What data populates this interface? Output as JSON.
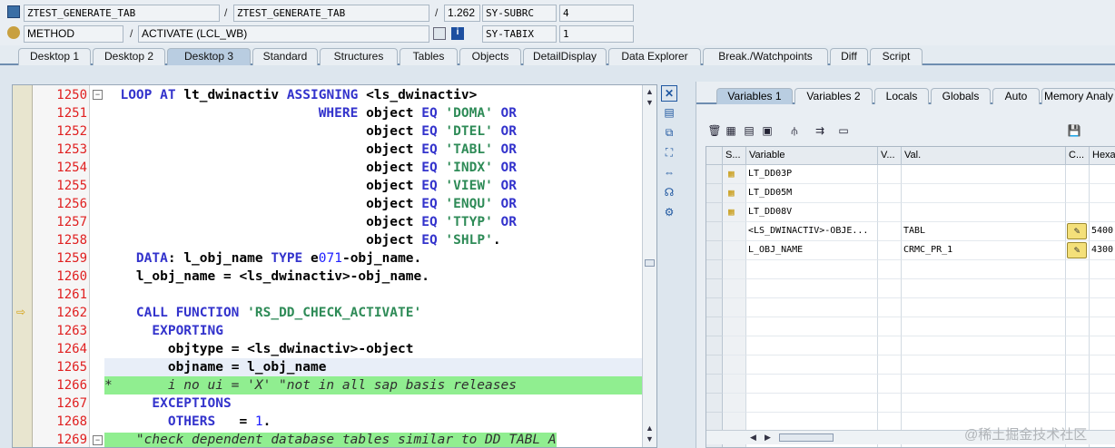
{
  "header": {
    "row1": {
      "program": "ZTEST_GENERATE_TAB",
      "include": "ZTEST_GENERATE_TAB",
      "line": "1.262",
      "sysfield": "SY-SUBRC",
      "sysvalue": "4"
    },
    "row2": {
      "eventtype": "METHOD",
      "event": "ACTIVATE (LCL_WB)",
      "sysfield": "SY-TABIX",
      "sysvalue": "1"
    },
    "sep": "/"
  },
  "tabs": [
    "Desktop 1",
    "Desktop 2",
    "Desktop 3",
    "Standard",
    "Structures",
    "Tables",
    "Objects",
    "DetailDisplay",
    "Data Explorer",
    "Break./Watchpoints",
    "Diff",
    "Script"
  ],
  "active_tab": "Desktop 3",
  "editor": {
    "lines": [
      {
        "n": "1250",
        "text": "  LOOP AT lt_dwinactiv ASSIGNING <ls_dwinactiv>"
      },
      {
        "n": "1251",
        "text": "                           WHERE object EQ 'DOMA' OR"
      },
      {
        "n": "1252",
        "text": "                                 object EQ 'DTEL' OR"
      },
      {
        "n": "1253",
        "text": "                                 object EQ 'TABL' OR"
      },
      {
        "n": "1254",
        "text": "                                 object EQ 'INDX' OR"
      },
      {
        "n": "1255",
        "text": "                                 object EQ 'VIEW' OR"
      },
      {
        "n": "1256",
        "text": "                                 object EQ 'ENQU' OR"
      },
      {
        "n": "1257",
        "text": "                                 object EQ 'TTYP' OR"
      },
      {
        "n": "1258",
        "text": "                                 object EQ 'SHLP'."
      },
      {
        "n": "1259",
        "text": "    DATA: l_obj_name TYPE e071-obj_name."
      },
      {
        "n": "1260",
        "text": "    l_obj_name = <ls_dwinactiv>-obj_name."
      },
      {
        "n": "1261",
        "text": ""
      },
      {
        "n": "1262",
        "text": "    CALL FUNCTION 'RS_DD_CHECK_ACTIVATE'"
      },
      {
        "n": "1263",
        "text": "      EXPORTING"
      },
      {
        "n": "1264",
        "text": "        objtype = <ls_dwinactiv>-object"
      },
      {
        "n": "1265",
        "text": "        objname = l_obj_name"
      },
      {
        "n": "1266",
        "text": "*       i no ui = 'X' \"not in all sap basis releases"
      },
      {
        "n": "1267",
        "text": "      EXCEPTIONS"
      },
      {
        "n": "1268",
        "text": "        OTHERS   = 1."
      },
      {
        "n": "1269",
        "text": "    \"check dependent database tables similar to DD TABL A"
      }
    ]
  },
  "right_tabs": [
    "Variables 1",
    "Variables 2",
    "Locals",
    "Globals",
    "Auto",
    "Memory Analy"
  ],
  "right_active": "Variables 1",
  "grid": {
    "headers": [
      "S...",
      "Variable",
      "V...",
      "Val.",
      "C...",
      "Hexa"
    ],
    "rows": [
      {
        "var": "LT_DD03P",
        "val": "",
        "hex": "",
        "icon": "table-icon"
      },
      {
        "var": "LT_DD05M",
        "val": "",
        "hex": "",
        "icon": "table-icon"
      },
      {
        "var": "LT_DD08V",
        "val": "",
        "hex": "",
        "icon": "table-icon"
      },
      {
        "var": "<LS_DWINACTIV>-OBJE...",
        "val": "TABL",
        "hex": "5400",
        "icon": ""
      },
      {
        "var": "L_OBJ_NAME",
        "val": "CRMC_PR_1",
        "hex": "4300",
        "icon": ""
      }
    ]
  },
  "watermark": "@稀土掘金技术社区"
}
